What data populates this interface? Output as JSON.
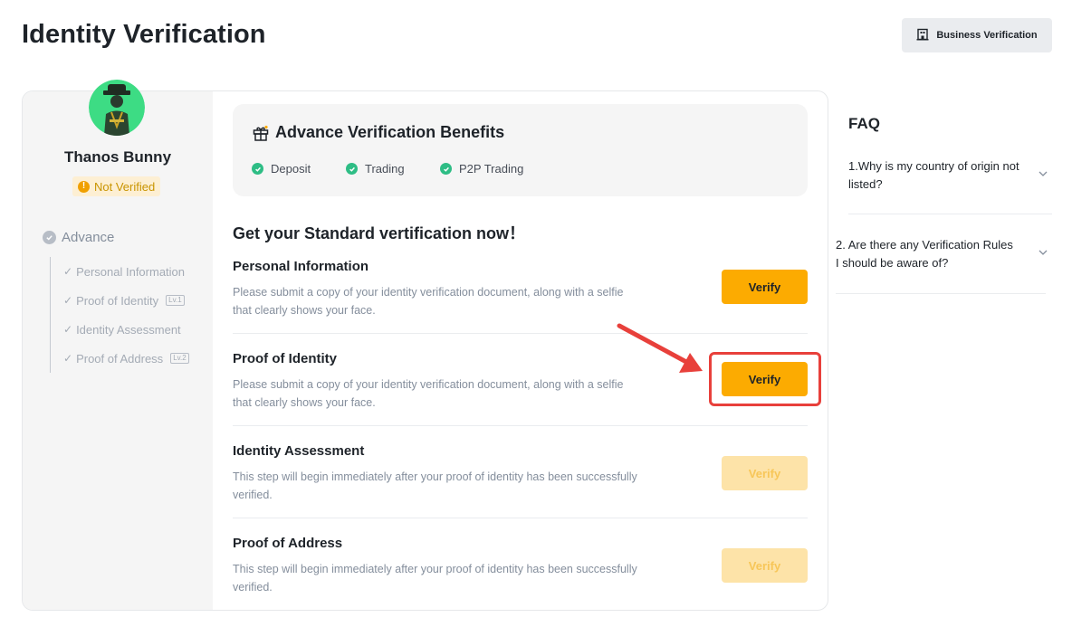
{
  "header": {
    "title": "Identity Verification",
    "business_button": "Business Verification"
  },
  "profile": {
    "name": "Thanos Bunny",
    "status": "Not Verified"
  },
  "sidebar": {
    "level": "Advance",
    "steps": [
      {
        "label": "Personal Information",
        "badge": ""
      },
      {
        "label": "Proof of Identity",
        "badge": "Lv.1"
      },
      {
        "label": "Identity Assessment",
        "badge": ""
      },
      {
        "label": "Proof of Address",
        "badge": "Lv.2"
      }
    ]
  },
  "benefits": {
    "title": "Advance Verification Benefits",
    "items": [
      "Deposit",
      "Trading",
      "P2P Trading"
    ]
  },
  "main": {
    "heading": "Get your Standard vertification now！",
    "sections": [
      {
        "title": "Personal Information",
        "description": "Please submit a copy of your identity verification document, along with a selfie that clearly shows your face.",
        "button": "Verify",
        "enabled": true
      },
      {
        "title": "Proof of Identity",
        "description": "Please submit a copy of your identity verification document, along with a selfie that clearly shows your face.",
        "button": "Verify",
        "enabled": true
      },
      {
        "title": "Identity Assessment",
        "description": "This step will begin immediately after your proof of identity has been successfully verified.",
        "button": "Verify",
        "enabled": false
      },
      {
        "title": "Proof of Address",
        "description": "This step will begin immediately after your proof of identity has been successfully verified.",
        "button": "Verify",
        "enabled": false
      }
    ]
  },
  "faq": {
    "title": "FAQ",
    "items": [
      {
        "question": "1.Why is my country of origin not listed?"
      },
      {
        "question": "2. Are there any Verification Rules I should be aware of?"
      }
    ]
  },
  "colors": {
    "accent": "#fcab01",
    "accent_disabled": "#fde3a8",
    "success": "#2ebd85",
    "warning": "#f0a000",
    "annotation_red": "#e8403b"
  }
}
